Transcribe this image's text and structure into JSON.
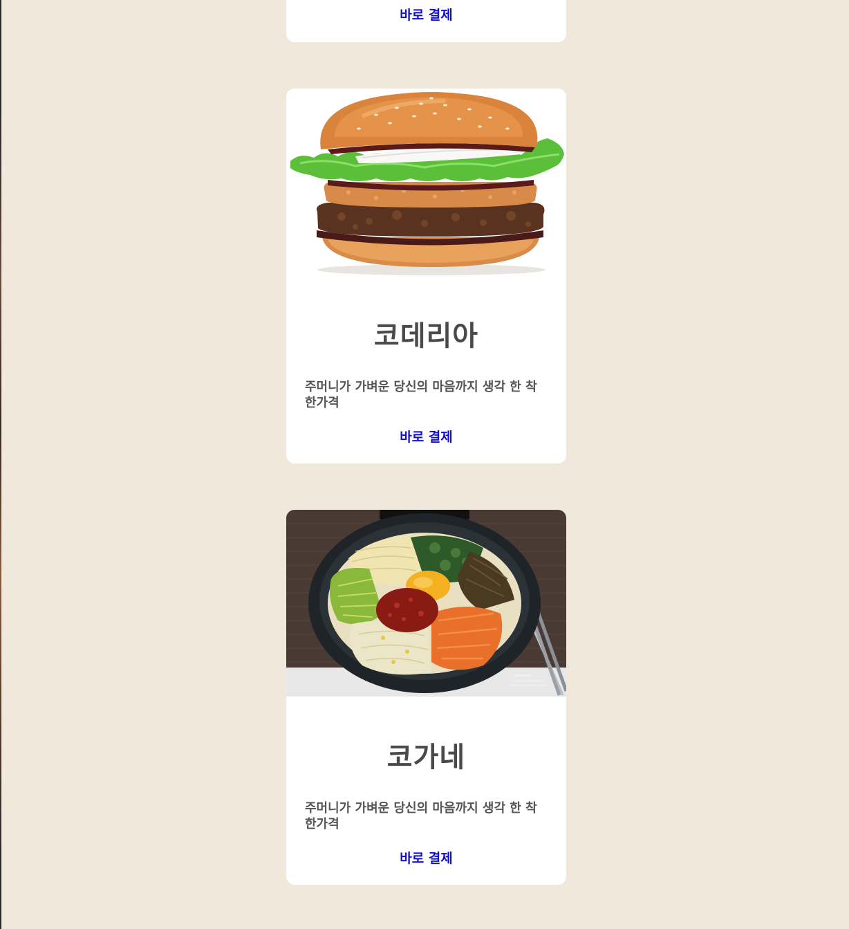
{
  "cards": [
    {
      "pay_label": "바로 결제"
    },
    {
      "image_subject": "burger",
      "title": "코데리아",
      "description": "주머니가 가벼운 당신의 마음까지 생각 한 착한가격",
      "pay_label": "바로 결제"
    },
    {
      "image_subject": "bibimbap",
      "title": "코가네",
      "description": "주머니가 가벼운 당신의 마음까지 생각 한 착한가격",
      "pay_label": "바로 결제"
    }
  ],
  "colors": {
    "page_background": "#f0e8da",
    "card_background": "#ffffff",
    "title_text": "#4a4a4a",
    "pay_link": "#1010cc"
  }
}
